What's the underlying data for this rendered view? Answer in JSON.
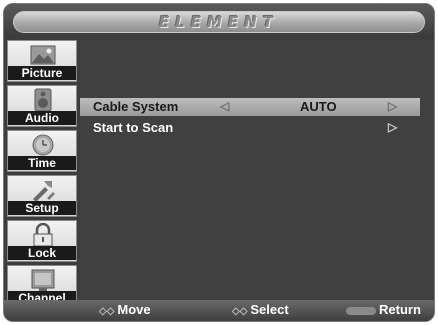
{
  "header": {
    "brand": "ELEMENT"
  },
  "sidebar": {
    "items": [
      {
        "label": "Picture",
        "icon": "picture-icon"
      },
      {
        "label": "Audio",
        "icon": "speaker-icon"
      },
      {
        "label": "Time",
        "icon": "clock-icon"
      },
      {
        "label": "Setup",
        "icon": "setup-tools-icon"
      },
      {
        "label": "Lock",
        "icon": "padlock-icon"
      },
      {
        "label": "Channel",
        "icon": "tv-channel-icon"
      }
    ]
  },
  "menu": {
    "rows": [
      {
        "label": "Cable System",
        "value": "AUTO",
        "selected": true
      },
      {
        "label": "Start to Scan",
        "value": "",
        "selected": false
      }
    ]
  },
  "footer": {
    "move": "Move",
    "select": "Select",
    "return": "Return"
  },
  "colors": {
    "panel": "#3d3d3d",
    "highlight": "#a9a9a9"
  }
}
